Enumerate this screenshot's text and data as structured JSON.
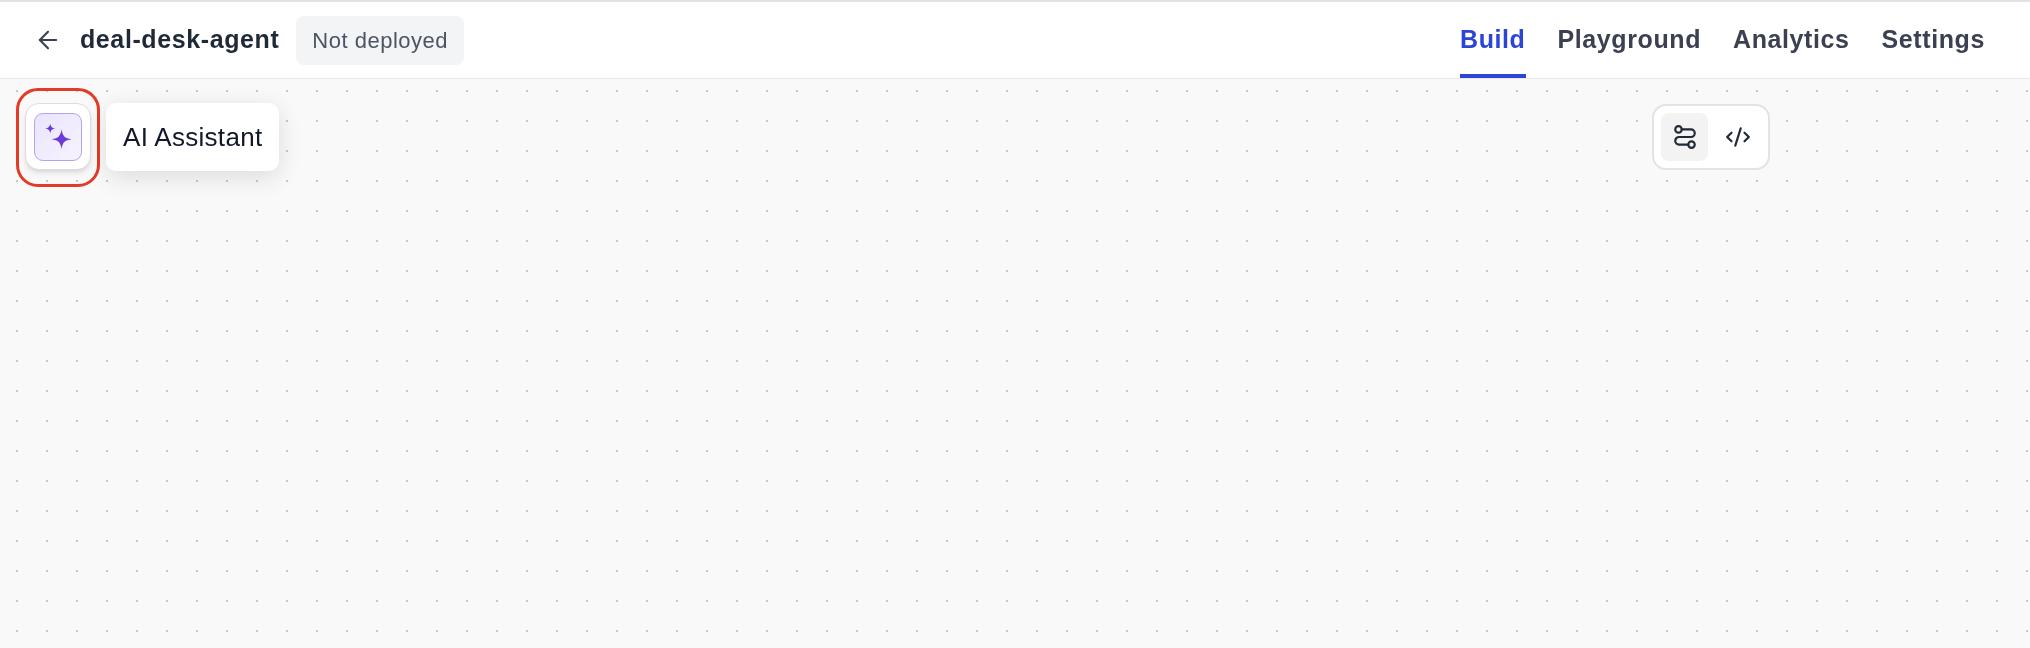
{
  "header": {
    "title": "deal-desk-agent",
    "status_badge": "Not deployed"
  },
  "tabs": [
    {
      "label": "Build",
      "selected": true
    },
    {
      "label": "Playground",
      "selected": false
    },
    {
      "label": "Analytics",
      "selected": false
    },
    {
      "label": "Settings",
      "selected": false
    }
  ],
  "canvas": {
    "assistant_button": {
      "highlighted": true,
      "tooltip": "AI Assistant"
    },
    "view_toggle": [
      {
        "kind": "flow",
        "selected": true
      },
      {
        "kind": "code",
        "selected": false
      }
    ]
  }
}
